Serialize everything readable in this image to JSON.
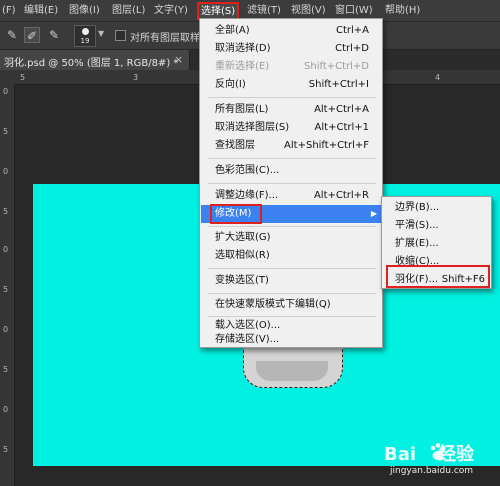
{
  "menubar": {
    "items": [
      "(F)",
      "编辑(E)",
      "图像(I)",
      "图层(L)",
      "文字(Y)",
      "选择(S)",
      "滤镜(T)",
      "视图(V)",
      "窗口(W)",
      "帮助(H)"
    ]
  },
  "options_bar": {
    "brush_size": "19",
    "checkbox_label": "对所有图层取样"
  },
  "document_tab": {
    "title": "羽化.psd @ 50% (图层 1, RGB/8#) *",
    "close": "×"
  },
  "rulers": {
    "top": [
      "5",
      "3",
      "4"
    ],
    "left": [
      "0",
      "5",
      "0",
      "5",
      "0",
      "5",
      "0",
      "5",
      "0",
      "5"
    ]
  },
  "select_menu": {
    "items": [
      {
        "label": "全部(A)",
        "shortcut": "Ctrl+A",
        "disabled": false
      },
      {
        "label": "取消选择(D)",
        "shortcut": "Ctrl+D",
        "disabled": false
      },
      {
        "label": "重新选择(E)",
        "shortcut": "Shift+Ctrl+D",
        "disabled": true
      },
      {
        "label": "反向(I)",
        "shortcut": "Shift+Ctrl+I",
        "disabled": false
      },
      {
        "label": "所有图层(L)",
        "shortcut": "Alt+Ctrl+A",
        "disabled": false
      },
      {
        "label": "取消选择图层(S)",
        "shortcut": "Alt+Ctrl+1",
        "disabled": false
      },
      {
        "label": "查找图层",
        "shortcut": "Alt+Shift+Ctrl+F",
        "disabled": false
      },
      {
        "label": "色彩范围(C)...",
        "shortcut": "",
        "disabled": false
      },
      {
        "label": "调整边缘(F)...",
        "shortcut": "Alt+Ctrl+R",
        "disabled": false
      },
      {
        "label": "修改(M)",
        "shortcut": "",
        "disabled": false
      },
      {
        "label": "扩大选取(G)",
        "shortcut": "",
        "disabled": false
      },
      {
        "label": "选取相似(R)",
        "shortcut": "",
        "disabled": false
      },
      {
        "label": "变换选区(T)",
        "shortcut": "",
        "disabled": false
      },
      {
        "label": "在快速蒙版模式下编辑(Q)",
        "shortcut": "",
        "disabled": false
      },
      {
        "label": "载入选区(O)...",
        "shortcut": "",
        "disabled": false
      },
      {
        "label": "存储选区(V)...",
        "shortcut": "",
        "disabled": false
      }
    ]
  },
  "modify_submenu": {
    "items": [
      {
        "label": "边界(B)...",
        "shortcut": ""
      },
      {
        "label": "平滑(S)...",
        "shortcut": ""
      },
      {
        "label": "扩展(E)...",
        "shortcut": ""
      },
      {
        "label": "收缩(C)...",
        "shortcut": ""
      },
      {
        "label": "羽化(F)...",
        "shortcut": "Shift+F6"
      }
    ]
  },
  "watermark": {
    "brand_left": "Bai",
    "brand_right": "经验",
    "url": "jingyan.baidu.com"
  },
  "colors": {
    "canvas": "#00f1e1",
    "highlight": "#3b82f0",
    "annotation_red": "#e0201e"
  }
}
